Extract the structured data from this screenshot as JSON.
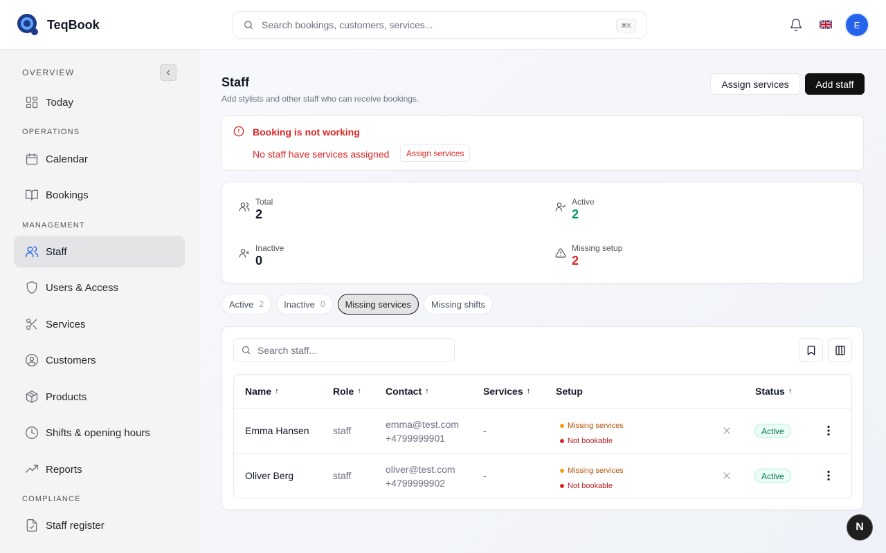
{
  "app": {
    "name": "TeqBook"
  },
  "header": {
    "search_placeholder": "Search bookings, customers, services...",
    "shortcut": "⌘K",
    "avatar_initial": "E"
  },
  "sidebar": {
    "sections": {
      "overview": "OVERVIEW",
      "operations": "OPERATIONS",
      "management": "MANAGEMENT",
      "compliance": "COMPLIANCE"
    },
    "items": [
      {
        "label": "Today",
        "icon": "layout-grid-icon"
      },
      {
        "label": "Calendar",
        "icon": "calendar-icon"
      },
      {
        "label": "Bookings",
        "icon": "book-icon"
      },
      {
        "label": "Staff",
        "icon": "users-icon",
        "active": true
      },
      {
        "label": "Users & Access",
        "icon": "shield-icon"
      },
      {
        "label": "Services",
        "icon": "scissors-icon"
      },
      {
        "label": "Customers",
        "icon": "user-circle-icon"
      },
      {
        "label": "Products",
        "icon": "package-icon"
      },
      {
        "label": "Shifts & opening hours",
        "icon": "clock-icon"
      },
      {
        "label": "Reports",
        "icon": "trending-up-icon"
      },
      {
        "label": "Staff register",
        "icon": "file-check-icon"
      }
    ]
  },
  "page": {
    "title": "Staff",
    "subtitle": "Add stylists and other staff who can receive bookings.",
    "assign_services_label": "Assign services",
    "add_staff_label": "Add staff"
  },
  "alert": {
    "title": "Booking is not working",
    "message": "No staff have services assigned",
    "action_label": "Assign services"
  },
  "stats": {
    "total": {
      "label": "Total",
      "value": "2"
    },
    "active": {
      "label": "Active",
      "value": "2"
    },
    "inactive": {
      "label": "Inactive",
      "value": "0"
    },
    "missing": {
      "label": "Missing setup",
      "value": "2"
    }
  },
  "filters": [
    {
      "label": "Active",
      "count": "2"
    },
    {
      "label": "Inactive",
      "count": "0"
    },
    {
      "label": "Missing services",
      "selected": true
    },
    {
      "label": "Missing shifts"
    }
  ],
  "table": {
    "search_placeholder": "Search staff...",
    "columns": {
      "name": "Name",
      "role": "Role",
      "contact": "Contact",
      "services": "Services",
      "setup": "Setup",
      "status": "Status"
    },
    "sort_arrow": "↑",
    "rows": [
      {
        "name": "Emma Hansen",
        "role": "staff",
        "email": "emma@test.com",
        "phone": "+4799999901",
        "services": "-",
        "setup_warning": "Missing services",
        "setup_error": "Not bookable",
        "status": "Active"
      },
      {
        "name": "Oliver Berg",
        "role": "staff",
        "email": "oliver@test.com",
        "phone": "+4799999902",
        "services": "-",
        "setup_warning": "Missing services",
        "setup_error": "Not bookable",
        "status": "Active"
      }
    ]
  },
  "floating": {
    "label": "N"
  },
  "colors": {
    "accent": "#2563eb",
    "danger": "#dc2626",
    "success": "#059669",
    "warning": "#f59e0b"
  }
}
